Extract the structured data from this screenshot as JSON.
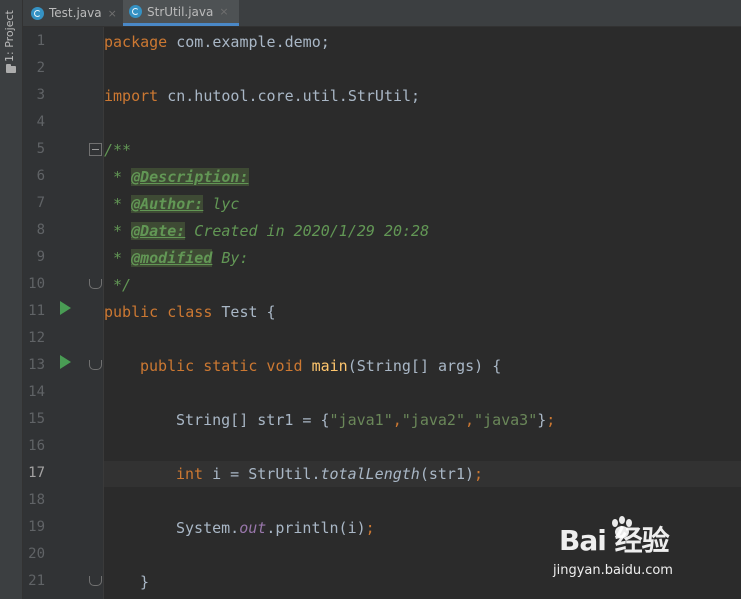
{
  "sidebar": {
    "project_label": "1: Project"
  },
  "tabs": [
    {
      "label": "Test.java",
      "close": "×",
      "active": false
    },
    {
      "label": "StrUtil.java",
      "close": "×",
      "active": true
    }
  ],
  "editor": {
    "current_line": 17,
    "line_numbers": [
      "1",
      "2",
      "3",
      "4",
      "5",
      "6",
      "7",
      "8",
      "9",
      "10",
      "11",
      "12",
      "13",
      "14",
      "15",
      "16",
      "17",
      "18",
      "19",
      "20",
      "21"
    ],
    "code": {
      "l1": {
        "kw": "package",
        "rest": " com.example.demo;"
      },
      "l3": {
        "kw": "import",
        "rest": " cn.hutool.core.util.StrUtil;"
      },
      "l5": "/**",
      "l6": {
        "pre": " * ",
        "tag": "@Description:",
        "post": ""
      },
      "l7": {
        "pre": " * ",
        "tag": "@Author:",
        "post": " lyc"
      },
      "l8": {
        "pre": " * ",
        "tag": "@Date:",
        "post": " Created in 2020/1/29 20:28"
      },
      "l9": {
        "pre": " * ",
        "tag": "@modified",
        "post": " By:"
      },
      "l10": " */",
      "l11": {
        "kw": "public class",
        "rest": " Test {"
      },
      "l13": {
        "kw": "public static void",
        "fn": "main",
        "rest": "(String[] args) {"
      },
      "l15": {
        "pre": "String[] str1 = {",
        "s1": "\"java1\"",
        "c1": ",",
        "s2": "\"java2\"",
        "c2": ",",
        "s3": "\"java3\"",
        "post": "}",
        "semi": ";"
      },
      "l17": {
        "kw": "int",
        "mid": " i = StrUtil.",
        "st": "totalLength",
        "post": "(str1)",
        "semi": ";"
      },
      "l19": {
        "pre": "System.",
        "fld": "out",
        "post": ".println(i)",
        "semi": ";"
      },
      "l21": "}"
    }
  },
  "watermark": {
    "logo": "Bai 经验",
    "url": "jingyan.baidu.com"
  },
  "colors": {
    "keyword": "#cc7832",
    "comment": "#629755",
    "string": "#6a8759",
    "method": "#ffc66d",
    "field": "#9876aa"
  }
}
